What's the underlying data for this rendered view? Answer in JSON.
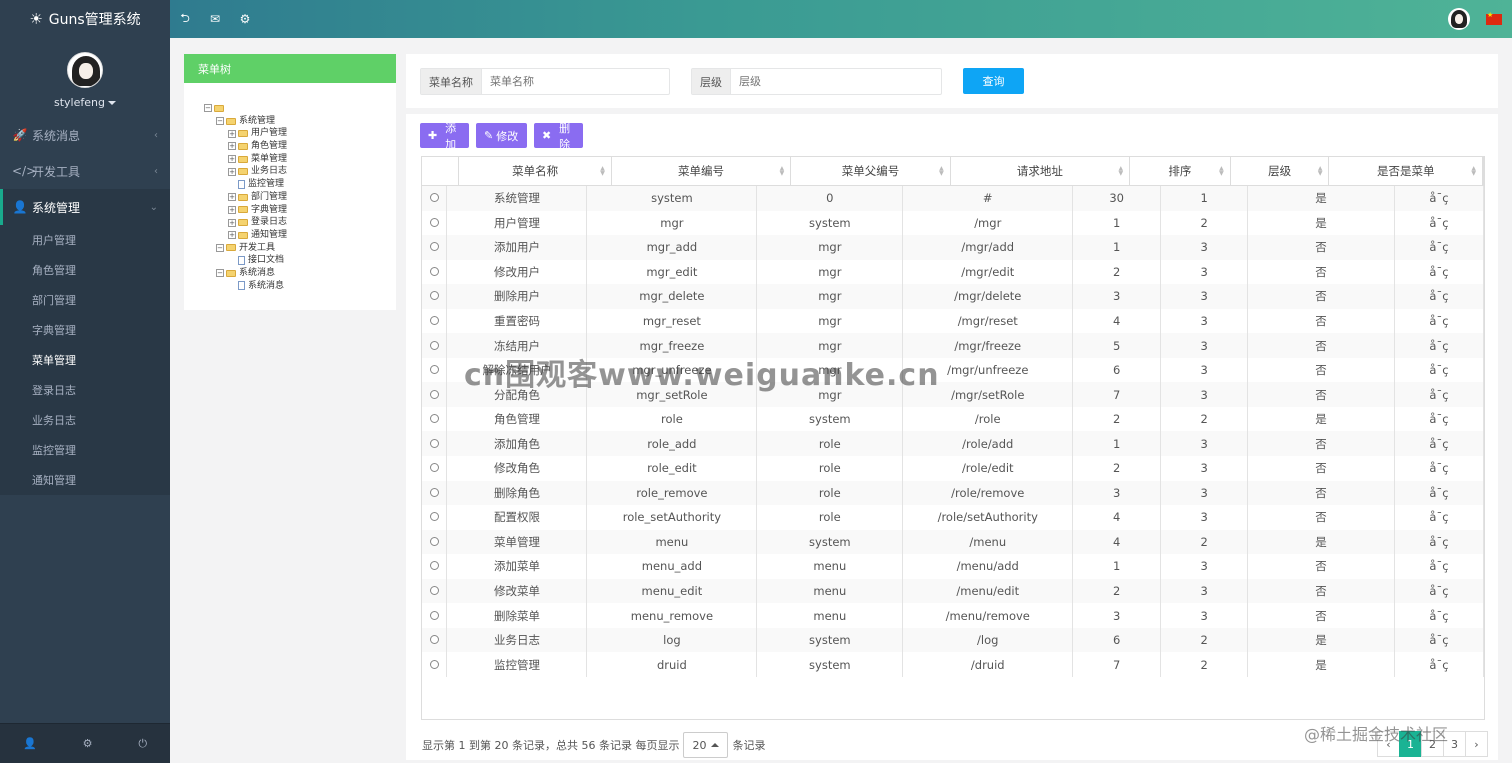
{
  "app": {
    "title": "Guns管理系统"
  },
  "user": {
    "name": "stylefeng"
  },
  "nav": [
    {
      "label": "系统消息",
      "icon": "rocket-icon",
      "glyph": "🚀",
      "active": false
    },
    {
      "label": "开发工具",
      "icon": "code-icon",
      "glyph": "</>",
      "active": false
    },
    {
      "label": "系统管理",
      "icon": "user-icon",
      "glyph": "👤",
      "active": true
    }
  ],
  "subnav": [
    {
      "label": "用户管理",
      "current": false
    },
    {
      "label": "角色管理",
      "current": false
    },
    {
      "label": "部门管理",
      "current": false
    },
    {
      "label": "字典管理",
      "current": false
    },
    {
      "label": "菜单管理",
      "current": true
    },
    {
      "label": "登录日志",
      "current": false
    },
    {
      "label": "业务日志",
      "current": false
    },
    {
      "label": "监控管理",
      "current": false
    },
    {
      "label": "通知管理",
      "current": false
    }
  ],
  "tree": {
    "title": "菜单树",
    "nodes": [
      {
        "label": "",
        "level": 0,
        "type": "folder",
        "toggle": "−"
      },
      {
        "label": "系统管理",
        "level": 1,
        "type": "folder",
        "toggle": "−"
      },
      {
        "label": "用户管理",
        "level": 2,
        "type": "folder",
        "toggle": "+"
      },
      {
        "label": "角色管理",
        "level": 2,
        "type": "folder",
        "toggle": "+"
      },
      {
        "label": "菜单管理",
        "level": 2,
        "type": "folder",
        "toggle": "+"
      },
      {
        "label": "业务日志",
        "level": 2,
        "type": "folder",
        "toggle": "+"
      },
      {
        "label": "监控管理",
        "level": 2,
        "type": "file",
        "toggle": ""
      },
      {
        "label": "部门管理",
        "level": 2,
        "type": "folder",
        "toggle": "+"
      },
      {
        "label": "字典管理",
        "level": 2,
        "type": "folder",
        "toggle": "+"
      },
      {
        "label": "登录日志",
        "level": 2,
        "type": "folder",
        "toggle": "+"
      },
      {
        "label": "通知管理",
        "level": 2,
        "type": "folder",
        "toggle": "+"
      },
      {
        "label": "开发工具",
        "level": 1,
        "type": "folder",
        "toggle": "−"
      },
      {
        "label": "接口文档",
        "level": 2,
        "type": "file",
        "toggle": ""
      },
      {
        "label": "系统消息",
        "level": 1,
        "type": "folder",
        "toggle": "−"
      },
      {
        "label": "系统消息",
        "level": 2,
        "type": "file",
        "toggle": ""
      }
    ]
  },
  "search": {
    "name_label": "菜单名称",
    "name_placeholder": "菜单名称",
    "level_label": "层级",
    "level_placeholder": "层级",
    "query_button": "查询"
  },
  "toolbar": {
    "add": "添加",
    "edit": "修改",
    "delete": "删除"
  },
  "table": {
    "columns": [
      "菜单名称",
      "菜单编号",
      "菜单父编号",
      "请求地址",
      "排序",
      "层级",
      "是否是菜单"
    ],
    "rows": [
      [
        "系统管理",
        "system",
        "0",
        "#",
        "30",
        "1",
        "是",
        "å¯ç"
      ],
      [
        "用户管理",
        "mgr",
        "system",
        "/mgr",
        "1",
        "2",
        "是",
        "å¯ç"
      ],
      [
        "添加用户",
        "mgr_add",
        "mgr",
        "/mgr/add",
        "1",
        "3",
        "否",
        "å¯ç"
      ],
      [
        "修改用户",
        "mgr_edit",
        "mgr",
        "/mgr/edit",
        "2",
        "3",
        "否",
        "å¯ç"
      ],
      [
        "删除用户",
        "mgr_delete",
        "mgr",
        "/mgr/delete",
        "3",
        "3",
        "否",
        "å¯ç"
      ],
      [
        "重置密码",
        "mgr_reset",
        "mgr",
        "/mgr/reset",
        "4",
        "3",
        "否",
        "å¯ç"
      ],
      [
        "冻结用户",
        "mgr_freeze",
        "mgr",
        "/mgr/freeze",
        "5",
        "3",
        "否",
        "å¯ç"
      ],
      [
        "解除冻结用户",
        "mgr_unfreeze",
        "mgr",
        "/mgr/unfreeze",
        "6",
        "3",
        "否",
        "å¯ç"
      ],
      [
        "分配角色",
        "mgr_setRole",
        "mgr",
        "/mgr/setRole",
        "7",
        "3",
        "否",
        "å¯ç"
      ],
      [
        "角色管理",
        "role",
        "system",
        "/role",
        "2",
        "2",
        "是",
        "å¯ç"
      ],
      [
        "添加角色",
        "role_add",
        "role",
        "/role/add",
        "1",
        "3",
        "否",
        "å¯ç"
      ],
      [
        "修改角色",
        "role_edit",
        "role",
        "/role/edit",
        "2",
        "3",
        "否",
        "å¯ç"
      ],
      [
        "删除角色",
        "role_remove",
        "role",
        "/role/remove",
        "3",
        "3",
        "否",
        "å¯ç"
      ],
      [
        "配置权限",
        "role_setAuthority",
        "role",
        "/role/setAuthority",
        "4",
        "3",
        "否",
        "å¯ç"
      ],
      [
        "菜单管理",
        "menu",
        "system",
        "/menu",
        "4",
        "2",
        "是",
        "å¯ç"
      ],
      [
        "添加菜单",
        "menu_add",
        "menu",
        "/menu/add",
        "1",
        "3",
        "否",
        "å¯ç"
      ],
      [
        "修改菜单",
        "menu_edit",
        "menu",
        "/menu/edit",
        "2",
        "3",
        "否",
        "å¯ç"
      ],
      [
        "删除菜单",
        "menu_remove",
        "menu",
        "/menu/remove",
        "3",
        "3",
        "否",
        "å¯ç"
      ],
      [
        "业务日志",
        "log",
        "system",
        "/log",
        "6",
        "2",
        "是",
        "å¯ç"
      ],
      [
        "监控管理",
        "druid",
        "system",
        "/druid",
        "7",
        "2",
        "是",
        "å¯ç"
      ]
    ]
  },
  "pagination": {
    "info": "显示第 1 到第 20 条记录，总共 56 条记录 每页显示",
    "page_size": "20",
    "suffix": "条记录",
    "pages": [
      "‹",
      "1",
      "2",
      "3",
      "›"
    ],
    "current_page": "1"
  },
  "watermarks": {
    "center": "cn围观客www.weiguanke.cn",
    "corner": "@稀土掘金技术社区"
  },
  "colors": {
    "sidebar_bg": "#2f4050",
    "accent_green": "#1ab394",
    "tree_header": "#5fd067",
    "query_button": "#0ea5f5",
    "toolbar_button": "#8a6cf1"
  }
}
